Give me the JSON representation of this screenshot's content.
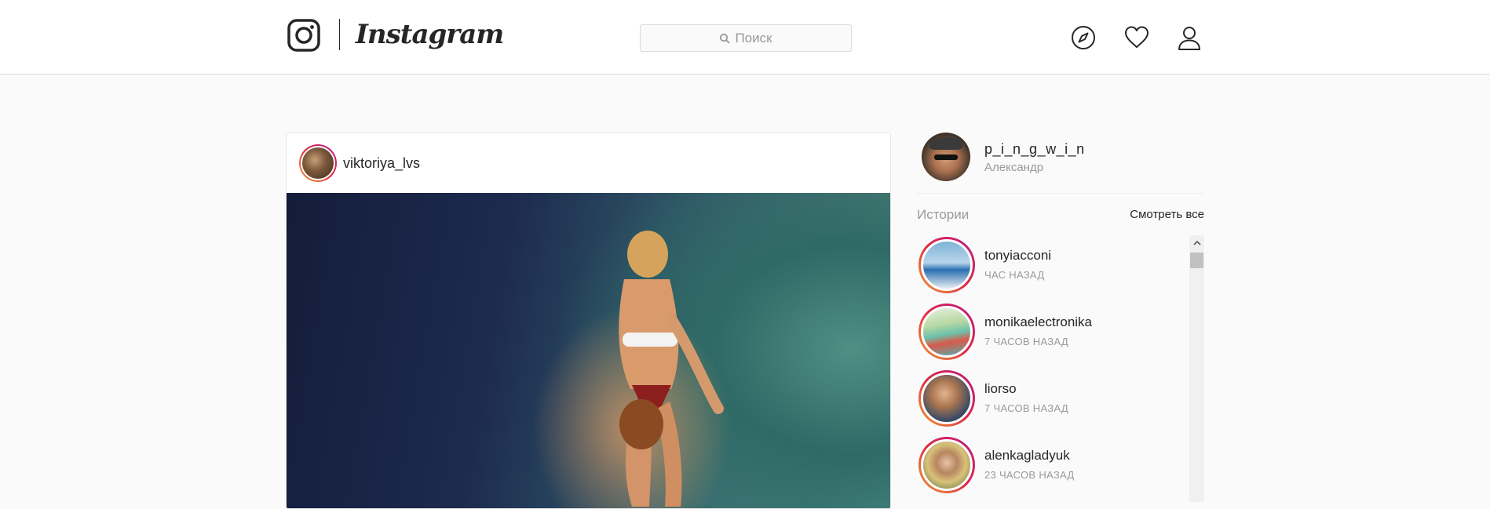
{
  "header": {
    "brand": "Instagram",
    "logo_icon": "instagram-camera-icon",
    "search": {
      "placeholder": "Поиск",
      "icon": "search-icon"
    },
    "nav_icons": [
      "compass-icon",
      "heart-icon",
      "user-icon"
    ]
  },
  "post": {
    "username": "viktoriya_lvs",
    "image_description": "underwater-diver-photo"
  },
  "sidebar": {
    "current_user": {
      "username": "p_i_n_g_w_i_n",
      "full_name": "Александр"
    },
    "stories": {
      "title": "Истории",
      "see_all": "Смотреть все",
      "items": [
        {
          "username": "tonyiacconi",
          "time": "ЧАС НАЗАД"
        },
        {
          "username": "monikaelectronika",
          "time": "7 ЧАСОВ НАЗАД"
        },
        {
          "username": "liorso",
          "time": "7 ЧАСОВ НАЗАД"
        },
        {
          "username": "alenkagladyuk",
          "time": "23 ЧАСОВ НАЗАД"
        }
      ]
    }
  },
  "colors": {
    "accent_gradient": [
      "#f09433",
      "#e6683c",
      "#dc2743",
      "#cc2366",
      "#bc1888"
    ],
    "text_primary": "#262626",
    "text_secondary": "#999999",
    "background": "#fafafa"
  }
}
